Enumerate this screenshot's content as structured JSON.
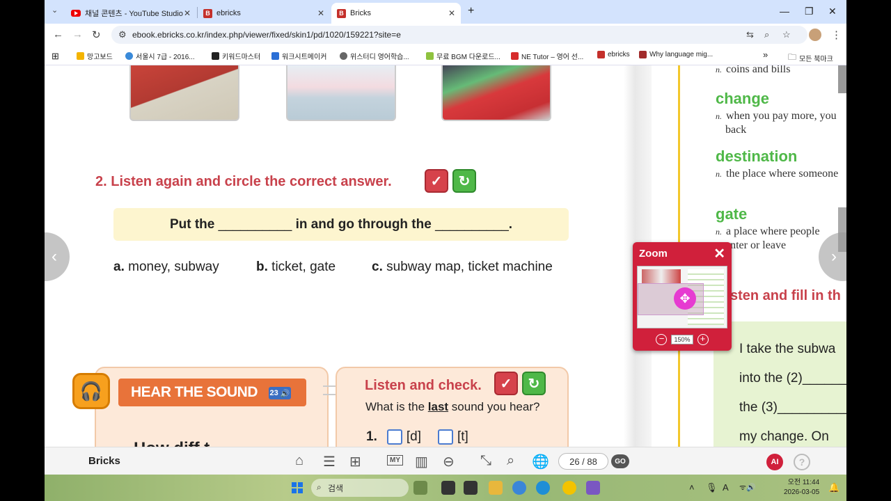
{
  "browser": {
    "tabs": [
      {
        "label": "채널 콘텐츠 - YouTube Studio",
        "icon": "youtube-icon"
      },
      {
        "label": "ebricks",
        "icon": "bricks-icon"
      },
      {
        "label": "Bricks",
        "icon": "bricks-icon",
        "active": true
      }
    ],
    "url": "ebook.ebricks.co.kr/index.php/viewer/fixed/skin1/pd/1020/159221?site=e",
    "bookmarks": [
      "망고보드",
      "서울시 7급 - 2016...",
      "키워드마스터",
      "워크시트메이커",
      "위스터디 영어학습...",
      "무료 BGM 다운로드...",
      "NE Tutor – 영어 선...",
      "ebricks",
      "Why language mig..."
    ],
    "bookmarks_more": "»",
    "all_bookmarks": "모든 북마크"
  },
  "page": {
    "q2_title": "2. Listen again and circle the correct answer.",
    "sentence_a": "Put the",
    "blank1": "__________",
    "sentence_b": "in and go through the",
    "blank2": "__________",
    "sentence_end": ".",
    "options": [
      {
        "letter": "a.",
        "text": "money, subway"
      },
      {
        "letter": "b.",
        "text": "ticket, gate"
      },
      {
        "letter": "c.",
        "text": "subway map, ticket machine"
      }
    ],
    "hear_banner": "HEAR THE SOUND",
    "track_no": "23",
    "listen_check": "Listen and check.",
    "last_q_pre": "What is the ",
    "last_q_word": "last",
    "last_q_post": " sound you hear?",
    "item1_num": "1.",
    "item1_opt1": "[d]",
    "item1_opt2": "[t]",
    "partial_text": "How diff    t"
  },
  "right_page": {
    "def_top": "coins and bills",
    "vocab": [
      {
        "word": "change",
        "def": "when you pay more, you",
        "def2": "back"
      },
      {
        "word": "destination",
        "def": "the place where someone"
      },
      {
        "word": "gate",
        "def": "a place where people",
        "def2": "enter or leave"
      }
    ],
    "pos": "n.",
    "listen_fill": "sten and fill in th",
    "lines": [
      "I take the subwa",
      "into the (2)______",
      "the (3)__________",
      "my change. On"
    ]
  },
  "zoom": {
    "title": "Zoom",
    "close": "✕",
    "level": "150%",
    "minus": "−",
    "plus": "+"
  },
  "toolbar": {
    "logo": "Bricks",
    "page": "26 / 88",
    "go": "GO",
    "ai": "AI"
  },
  "taskbar": {
    "search": "검색",
    "time": "오전 11:44",
    "date": "2026-03-05"
  }
}
